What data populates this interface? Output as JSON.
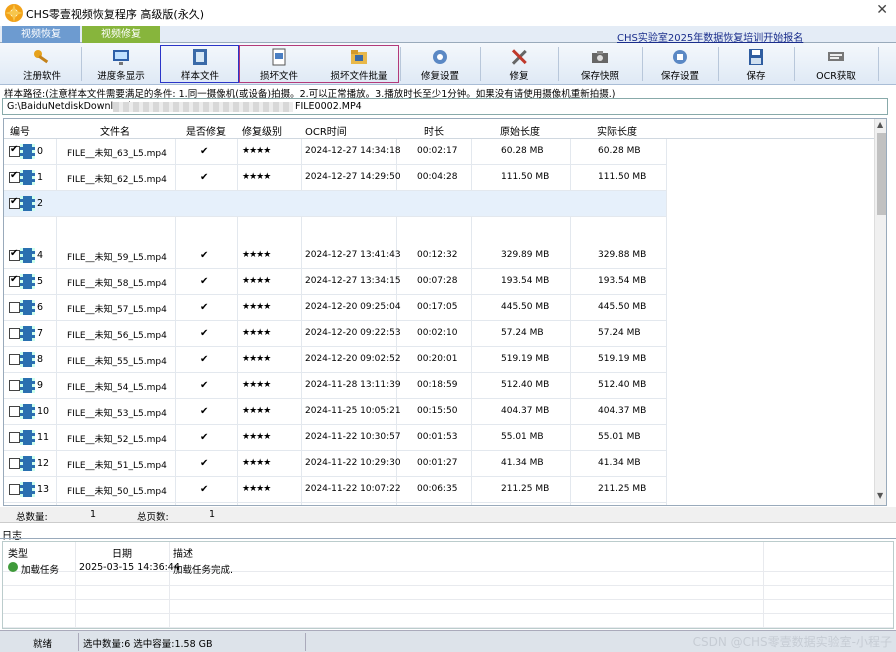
{
  "title_bar": {
    "title": "CHS零壹视频恢复程序 高级版(永久)",
    "close_icon": "close-icon",
    "logo_icon": "app-logo-icon"
  },
  "tabs": [
    {
      "label": "视频恢复",
      "color": "#6d9bd0"
    },
    {
      "label": "视频修复",
      "color": "#87b53c"
    }
  ],
  "ad_link": "CHS实验室2025年数据恢复培训开始报名",
  "toolbar": [
    {
      "label": "注册软件",
      "icon": "key-icon"
    },
    {
      "label": "进度条显示",
      "icon": "monitor-icon"
    },
    {
      "label": "样本文件",
      "icon": "film-icon"
    },
    {
      "label": "损坏文件",
      "icon": "document-icon"
    },
    {
      "label": "损坏文件批量",
      "icon": "folder-icon"
    },
    {
      "label": "修复设置",
      "icon": "settings-icon"
    },
    {
      "label": "修复",
      "icon": "tools-icon"
    },
    {
      "label": "保存快照",
      "icon": "camera-icon"
    },
    {
      "label": "保存设置",
      "icon": "save-settings-icon"
    },
    {
      "label": "保存",
      "icon": "save-icon"
    },
    {
      "label": "OCR获取",
      "icon": "ocr-icon"
    }
  ],
  "notice": "样本路径:(注意样本文件需要满足的条件: 1.同一摄像机(或设备)拍摄。2.可以正常播放。3.播放时长至少1分钟。如果没有请使用摄像机重新拍摄.)",
  "path": {
    "prefix": "G:\\BaiduNetdiskDownload\\",
    "suffix": "FILE0002.MP4"
  },
  "table": {
    "headers": [
      "编号",
      "文件名",
      "是否修复",
      "修复级别",
      "OCR时间",
      "时长",
      "原始长度",
      "实际长度"
    ],
    "rows": [
      {
        "checked": true,
        "index": "0",
        "name": "FILE__未知_63_L5.mp4",
        "fixed": "✔",
        "level": "★★★★",
        "ocr": "2024-12-27 14:34:18",
        "duration": "00:02:17",
        "orig": "60.28 MB",
        "actual": "60.28 MB"
      },
      {
        "checked": true,
        "index": "1",
        "name": "FILE__未知_62_L5.mp4",
        "fixed": "✔",
        "level": "★★★★",
        "ocr": "2024-12-27 14:29:50",
        "duration": "00:04:28",
        "orig": "111.50 MB",
        "actual": "111.50 MB"
      },
      {
        "checked": true,
        "index": "2",
        "name": "",
        "fixed": "",
        "level": "",
        "ocr": "",
        "duration": "",
        "orig": "",
        "actual": ""
      },
      {
        "checked": true,
        "index": "4",
        "name": "FILE__未知_59_L5.mp4",
        "fixed": "✔",
        "level": "★★★★",
        "ocr": "2024-12-27 13:41:43",
        "duration": "00:12:32",
        "orig": "329.89 MB",
        "actual": "329.88 MB"
      },
      {
        "checked": true,
        "index": "5",
        "name": "FILE__未知_58_L5.mp4",
        "fixed": "✔",
        "level": "★★★★",
        "ocr": "2024-12-27 13:34:15",
        "duration": "00:07:28",
        "orig": "193.54 MB",
        "actual": "193.54 MB"
      },
      {
        "checked": false,
        "index": "6",
        "name": "FILE__未知_57_L5.mp4",
        "fixed": "✔",
        "level": "★★★★",
        "ocr": "2024-12-20 09:25:04",
        "duration": "00:17:05",
        "orig": "445.50 MB",
        "actual": "445.50 MB"
      },
      {
        "checked": false,
        "index": "7",
        "name": "FILE__未知_56_L5.mp4",
        "fixed": "✔",
        "level": "★★★★",
        "ocr": "2024-12-20 09:22:53",
        "duration": "00:02:10",
        "orig": "57.24 MB",
        "actual": "57.24 MB"
      },
      {
        "checked": false,
        "index": "8",
        "name": "FILE__未知_55_L5.mp4",
        "fixed": "✔",
        "level": "★★★★",
        "ocr": "2024-12-20 09:02:52",
        "duration": "00:20:01",
        "orig": "519.19 MB",
        "actual": "519.19 MB"
      },
      {
        "checked": false,
        "index": "9",
        "name": "FILE__未知_54_L5.mp4",
        "fixed": "✔",
        "level": "★★★★",
        "ocr": "2024-11-28 13:11:39",
        "duration": "00:18:59",
        "orig": "512.40 MB",
        "actual": "512.40 MB"
      },
      {
        "checked": false,
        "index": "10",
        "name": "FILE__未知_53_L5.mp4",
        "fixed": "✔",
        "level": "★★★★",
        "ocr": "2024-11-25 10:05:21",
        "duration": "00:15:50",
        "orig": "404.37 MB",
        "actual": "404.37 MB"
      },
      {
        "checked": false,
        "index": "11",
        "name": "FILE__未知_52_L5.mp4",
        "fixed": "✔",
        "level": "★★★★",
        "ocr": "2024-11-22 10:30:57",
        "duration": "00:01:53",
        "orig": "55.01 MB",
        "actual": "55.01 MB"
      },
      {
        "checked": false,
        "index": "12",
        "name": "FILE__未知_51_L5.mp4",
        "fixed": "✔",
        "level": "★★★★",
        "ocr": "2024-11-22 10:29:30",
        "duration": "00:01:27",
        "orig": "41.34 MB",
        "actual": "41.34 MB"
      },
      {
        "checked": false,
        "index": "13",
        "name": "FILE__未知_50_L5.mp4",
        "fixed": "✔",
        "level": "★★★★",
        "ocr": "2024-11-22 10:07:22",
        "duration": "00:06:35",
        "orig": "211.25 MB",
        "actual": "211.25 MB"
      }
    ]
  },
  "totals": {
    "count_label": "总数量:",
    "count": "1",
    "pages_label": "总页数:",
    "pages": "1"
  },
  "log": {
    "title": "日志",
    "headers": [
      "类型",
      "日期",
      "描述"
    ],
    "entries": [
      {
        "type": "加载任务",
        "date": "2025-03-15 14:36:44",
        "desc": "加载任务完成."
      }
    ]
  },
  "status": {
    "ready": "就绪",
    "selection": "选中数量:6 选中容量:1.58 GB"
  },
  "watermark": "CSDN @CHS零壹数据实验室-小程子"
}
